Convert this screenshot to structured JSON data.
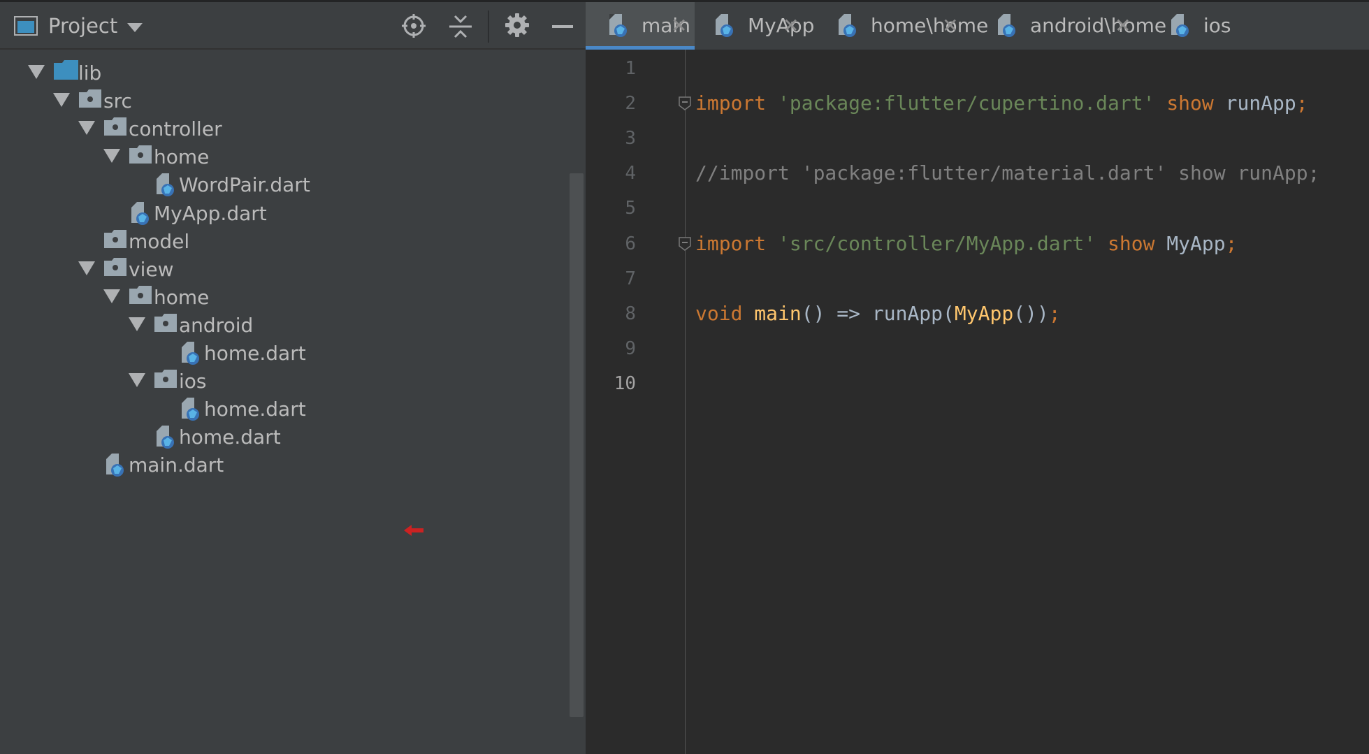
{
  "project_panel": {
    "title": "Project",
    "tree": [
      {
        "label": "lib",
        "kind": "folder-blue",
        "level": 0,
        "expanded": true
      },
      {
        "label": "src",
        "kind": "folder",
        "level": 1,
        "expanded": true
      },
      {
        "label": "controller",
        "kind": "folder",
        "level": 2,
        "expanded": true
      },
      {
        "label": "home",
        "kind": "folder",
        "level": 3,
        "expanded": true
      },
      {
        "label": "WordPair.dart",
        "kind": "dart-file",
        "level": 4
      },
      {
        "label": "MyApp.dart",
        "kind": "dart-file",
        "level": 3
      },
      {
        "label": "model",
        "kind": "folder",
        "level": 2
      },
      {
        "label": "view",
        "kind": "folder",
        "level": 2,
        "expanded": true
      },
      {
        "label": "home",
        "kind": "folder",
        "level": 3,
        "expanded": true
      },
      {
        "label": "android",
        "kind": "folder",
        "level": 4,
        "expanded": true
      },
      {
        "label": "home.dart",
        "kind": "dart-file",
        "level": 5
      },
      {
        "label": "ios",
        "kind": "folder",
        "level": 4,
        "expanded": true
      },
      {
        "label": "home.dart",
        "kind": "dart-file",
        "level": 5
      },
      {
        "label": "home.dart",
        "kind": "dart-file",
        "level": 4,
        "marked": true
      },
      {
        "label": "main.dart",
        "kind": "dart-file",
        "level": 2
      }
    ]
  },
  "editor": {
    "tabs": [
      {
        "label": "main",
        "active": true
      },
      {
        "label": "MyApp",
        "active": false
      },
      {
        "label": "home\\home",
        "active": false
      },
      {
        "label": "android\\home",
        "active": false
      },
      {
        "label": "ios",
        "active": false
      }
    ],
    "close_glyph": "✕",
    "current_line": 10,
    "lines": [
      {
        "no": "1",
        "tokens": []
      },
      {
        "no": "2",
        "fold": true,
        "tokens": [
          {
            "t": "import",
            "c": "kw"
          },
          {
            "t": " ",
            "c": ""
          },
          {
            "t": "'package:flutter/cupertino.dart'",
            "c": "str"
          },
          {
            "t": " ",
            "c": ""
          },
          {
            "t": "show",
            "c": "kw"
          },
          {
            "t": " runApp",
            "c": ""
          },
          {
            "t": ";",
            "c": "kw"
          }
        ]
      },
      {
        "no": "3",
        "tokens": []
      },
      {
        "no": "4",
        "tokens": [
          {
            "t": "//import 'package:flutter/material.dart' show runApp;",
            "c": "cmt"
          }
        ]
      },
      {
        "no": "5",
        "tokens": []
      },
      {
        "no": "6",
        "fold": true,
        "tokens": [
          {
            "t": "import",
            "c": "kw"
          },
          {
            "t": " ",
            "c": ""
          },
          {
            "t": "'src/controller/MyApp.dart'",
            "c": "str"
          },
          {
            "t": " ",
            "c": ""
          },
          {
            "t": "show",
            "c": "kw"
          },
          {
            "t": " MyApp",
            "c": ""
          },
          {
            "t": ";",
            "c": "kw"
          }
        ]
      },
      {
        "no": "7",
        "tokens": []
      },
      {
        "no": "8",
        "tokens": [
          {
            "t": "void",
            "c": "kw"
          },
          {
            "t": " ",
            "c": ""
          },
          {
            "t": "main",
            "c": "fn"
          },
          {
            "t": "() => runApp(",
            "c": ""
          },
          {
            "t": "MyApp",
            "c": "ctor"
          },
          {
            "t": "())",
            "c": ""
          },
          {
            "t": ";",
            "c": "kw"
          }
        ]
      },
      {
        "no": "9",
        "tokens": []
      },
      {
        "no": "10",
        "tokens": []
      }
    ]
  },
  "colors": {
    "panel_bg": "#3c3f41",
    "editor_bg": "#2b2b2b",
    "active_tab_underline": "#4a88c7",
    "marker_arrow": "#cc2222"
  },
  "icons": {
    "project_view": "project-view-icon",
    "dropdown": "chevron-down-icon",
    "locate": "locate-icon",
    "collapse": "collapse-all-icon",
    "settings": "gear-icon",
    "hide": "minimize-icon",
    "folder": "folder-icon",
    "dart_file": "dart-file-icon",
    "marker": "red-arrow-icon"
  }
}
